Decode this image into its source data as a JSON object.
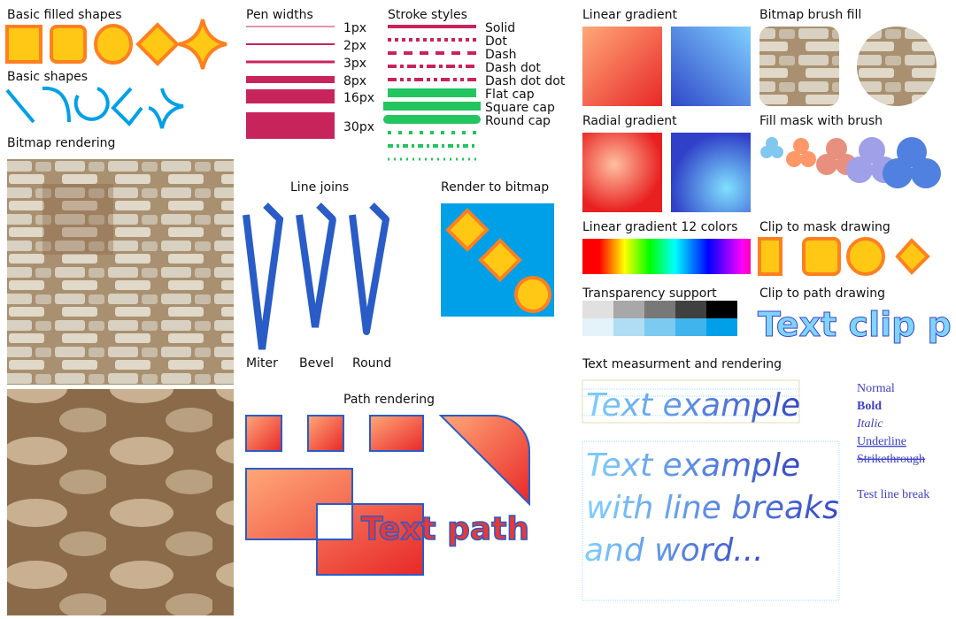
{
  "sections": {
    "basic_filled": "Basic filled shapes",
    "basic_shapes": "Basic shapes",
    "bitmap_rendering": "Bitmap rendering",
    "pen_widths": "Pen widths",
    "stroke_styles": "Stroke styles",
    "linear_gradient": "Linear gradient",
    "bitmap_brush": "Bitmap brush fill",
    "radial_gradient": "Radial gradient",
    "fill_mask": "Fill mask with brush",
    "gradient12": "Linear gradient 12 colors",
    "clip_mask": "Clip to mask drawing",
    "transparency": "Transparency support",
    "clip_path": "Clip to path drawing",
    "line_joins": "Line joins",
    "render_bitmap": "Render to bitmap",
    "text_measure": "Text measurment and rendering",
    "path_rendering": "Path rendering"
  },
  "pen_widths": [
    "1px",
    "2px",
    "3px",
    "8px",
    "16px",
    "30px"
  ],
  "stroke_styles": [
    "Solid",
    "Dot",
    "Dash",
    "Dash dot",
    "Dash dot dot",
    "Flat cap",
    "Square cap",
    "Round cap"
  ],
  "joins": [
    "Miter",
    "Bevel",
    "Round"
  ],
  "clip_text": "Text clip p",
  "path_text": "Text path",
  "text_example": "Text example",
  "text_multiline": [
    "Text example",
    "with line breaks",
    "and word..."
  ],
  "font_styles": [
    "Normal",
    "Bold",
    "Italic",
    "Underline",
    "Strikethrough"
  ],
  "line_break": "Test line break",
  "colors": {
    "fill": "#ffc815",
    "stroke": "#ff8020",
    "blue": "#00a0e8",
    "pen": "#c8245c",
    "green": "#22c55e",
    "join": "#2a5cc8"
  }
}
